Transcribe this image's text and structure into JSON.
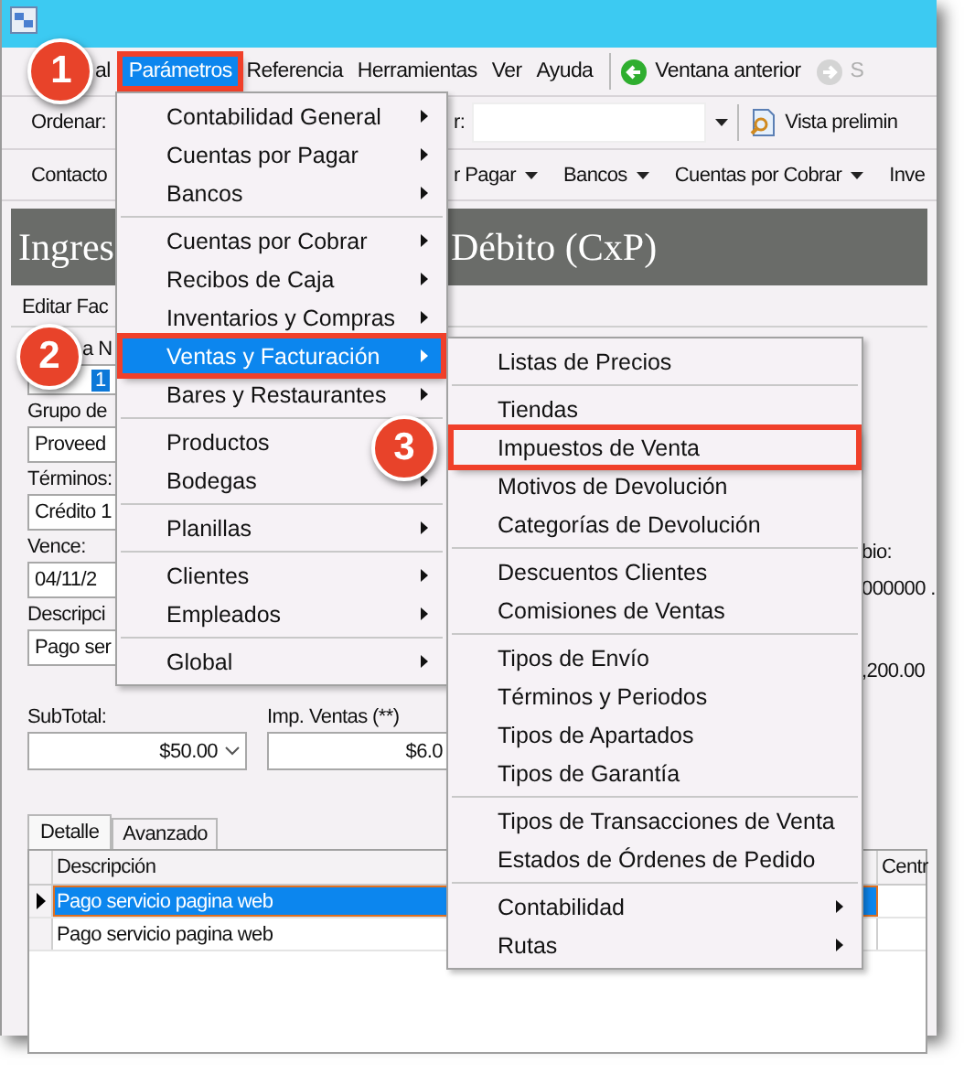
{
  "menubar": {
    "items": [
      {
        "label": "al",
        "selected": false,
        "highlighted": false
      },
      {
        "label": "Parámetros",
        "selected": true,
        "highlighted": true,
        "badge": "1"
      },
      {
        "label": "Referencia",
        "selected": false,
        "highlighted": false
      },
      {
        "label": "Herramientas",
        "selected": false,
        "highlighted": false
      },
      {
        "label": "Ver",
        "selected": false,
        "highlighted": false
      },
      {
        "label": "Ayuda",
        "selected": false,
        "highlighted": false
      }
    ],
    "nav_buttons": [
      {
        "label": "Ventana anterior",
        "disabled": false
      },
      {
        "label": "S",
        "disabled": true
      }
    ]
  },
  "toolbar": {
    "sort_label": "Ordenar:",
    "filter_label": "r:",
    "preview_button": "Vista prelimin"
  },
  "module_bar": [
    {
      "label": "Contacto",
      "dropdown": false
    },
    {
      "label": "r Pagar",
      "dropdown": true
    },
    {
      "label": "Bancos",
      "dropdown": true
    },
    {
      "label": "Cuentas por Cobrar",
      "dropdown": true
    },
    {
      "label": "Inve",
      "dropdown": false
    }
  ],
  "banner": {
    "title_parts": [
      "Ingres",
      "Débito (CxP)"
    ]
  },
  "form_tab": "Editar Fac",
  "form": {
    "fields": [
      {
        "label": "a N",
        "value": "1",
        "selected": true
      },
      {
        "label": "Grupo de",
        "value": "Proveed",
        "selected": false
      },
      {
        "label": "Términos:",
        "value": "Crédito 1",
        "selected": false
      },
      {
        "label": "Vence:",
        "value": "04/11/2",
        "selected": false
      },
      {
        "label": "Descripci",
        "value": "Pago ser",
        "selected": false
      }
    ],
    "column_3": [
      "bio:",
      "000000 .",
      ",200.00"
    ],
    "totals": [
      {
        "label": "SubTotal:",
        "value": "$50.00",
        "dropdown": true
      },
      {
        "label": "Imp. Ventas (**)",
        "value": "$6.0",
        "dropdown": false
      }
    ]
  },
  "detail_tabs": [
    {
      "label": "Detalle",
      "selected": true
    },
    {
      "label": "Avanzado",
      "selected": false
    }
  ],
  "grid": {
    "columns": [
      "Descripción",
      "Centr"
    ],
    "rows": [
      {
        "cells": [
          "Pago servicio pagina web"
        ],
        "selected": true
      },
      {
        "cells": [
          "Pago servicio pagina web"
        ],
        "selected": false
      }
    ]
  },
  "menus": [
    {
      "items": [
        {
          "kind": "item",
          "label": "Contabilidad General",
          "submenu": true,
          "selected": false,
          "highlighted": false
        },
        {
          "kind": "item",
          "label": "Cuentas por Pagar",
          "submenu": true,
          "selected": false,
          "highlighted": false
        },
        {
          "kind": "item",
          "label": "Bancos",
          "submenu": true,
          "selected": false,
          "highlighted": false
        },
        {
          "kind": "separator"
        },
        {
          "kind": "item",
          "label": "Cuentas por Cobrar",
          "submenu": true,
          "selected": false,
          "highlighted": false
        },
        {
          "kind": "item",
          "label": "Recibos de Caja",
          "submenu": true,
          "selected": false,
          "highlighted": false
        },
        {
          "kind": "item",
          "label": "Inventarios y Compras",
          "submenu": true,
          "selected": false,
          "highlighted": false
        },
        {
          "kind": "item",
          "label": "Ventas y Facturación",
          "submenu": true,
          "selected": true,
          "highlighted": true,
          "badge": "2"
        },
        {
          "kind": "item",
          "label": "Bares y Restaurantes",
          "submenu": true,
          "selected": false,
          "highlighted": false
        },
        {
          "kind": "separator"
        },
        {
          "kind": "item",
          "label": "Productos",
          "submenu": false,
          "selected": false,
          "highlighted": false
        },
        {
          "kind": "item",
          "label": "Bodegas",
          "submenu": true,
          "selected": false,
          "highlighted": false
        },
        {
          "kind": "separator"
        },
        {
          "kind": "item",
          "label": "Planillas",
          "submenu": true,
          "selected": false,
          "highlighted": false
        },
        {
          "kind": "separator"
        },
        {
          "kind": "item",
          "label": "Clientes",
          "submenu": true,
          "selected": false,
          "highlighted": false
        },
        {
          "kind": "item",
          "label": "Empleados",
          "submenu": true,
          "selected": false,
          "highlighted": false
        },
        {
          "kind": "separator"
        },
        {
          "kind": "item",
          "label": "Global",
          "submenu": true,
          "selected": false,
          "highlighted": false
        }
      ]
    },
    {
      "items": [
        {
          "kind": "item",
          "label": "Listas de Precios",
          "submenu": false,
          "selected": false,
          "highlighted": false
        },
        {
          "kind": "separator"
        },
        {
          "kind": "item",
          "label": "Tiendas",
          "submenu": false,
          "selected": false,
          "highlighted": false
        },
        {
          "kind": "item",
          "label": "Impuestos de Venta",
          "submenu": false,
          "selected": false,
          "highlighted": true,
          "badge": "3"
        },
        {
          "kind": "item",
          "label": "Motivos de Devolución",
          "submenu": false,
          "selected": false,
          "highlighted": false
        },
        {
          "kind": "item",
          "label": "Categorías de Devolución",
          "submenu": false,
          "selected": false,
          "highlighted": false
        },
        {
          "kind": "separator"
        },
        {
          "kind": "item",
          "label": "Descuentos Clientes",
          "submenu": false,
          "selected": false,
          "highlighted": false
        },
        {
          "kind": "item",
          "label": "Comisiones de Ventas",
          "submenu": false,
          "selected": false,
          "highlighted": false
        },
        {
          "kind": "separator"
        },
        {
          "kind": "item",
          "label": "Tipos de Envío",
          "submenu": false,
          "selected": false,
          "highlighted": false
        },
        {
          "kind": "item",
          "label": "Términos y Periodos",
          "submenu": false,
          "selected": false,
          "highlighted": false
        },
        {
          "kind": "item",
          "label": "Tipos de Apartados",
          "submenu": false,
          "selected": false,
          "highlighted": false
        },
        {
          "kind": "item",
          "label": "Tipos de Garantía",
          "submenu": false,
          "selected": false,
          "highlighted": false
        },
        {
          "kind": "separator"
        },
        {
          "kind": "item",
          "label": "Tipos de Transacciones de Venta",
          "submenu": false,
          "selected": false,
          "highlighted": false
        },
        {
          "kind": "item",
          "label": "Estados de Órdenes de Pedido",
          "submenu": false,
          "selected": false,
          "highlighted": false
        },
        {
          "kind": "separator"
        },
        {
          "kind": "item",
          "label": "Contabilidad",
          "submenu": true,
          "selected": false,
          "highlighted": false
        },
        {
          "kind": "item",
          "label": "Rutas",
          "submenu": true,
          "selected": false,
          "highlighted": false
        }
      ]
    }
  ]
}
